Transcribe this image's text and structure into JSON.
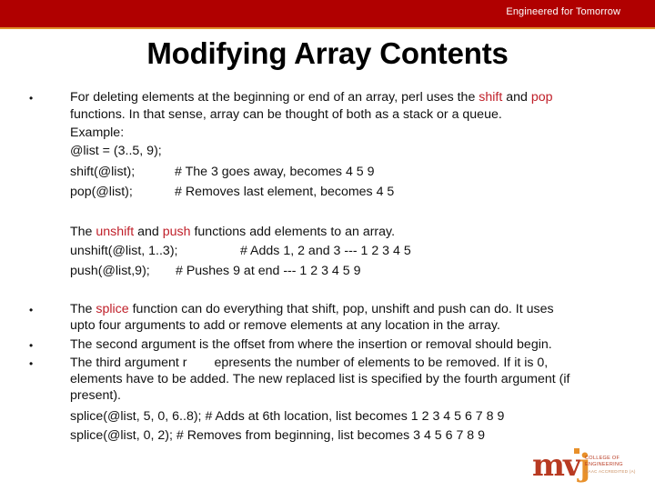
{
  "header": {
    "tagline": "Engineered for Tomorrow",
    "bar_color": "#b00000",
    "accent_color": "#e0902a"
  },
  "slide": {
    "title": "Modifying Array Contents",
    "highlight_color": "#c0202a",
    "section1": {
      "line1_pre": "For deleting elements at the beginning or end of an array, perl uses the ",
      "line1_kw1": "shift",
      "line1_mid": " and ",
      "line1_kw2": "pop",
      "line2": "functions. In that sense, array can be thought of both as a stack or a queue.",
      "example_label": "Example:",
      "code1": "@list = (3..5, 9);",
      "code2_stmt": "shift(@list);",
      "code2_comment": "# The 3 goes away, becomes 4 5 9",
      "code3_stmt": "pop(@list);",
      "code3_comment": "# Removes last element, becomes 4  5"
    },
    "section2": {
      "line1_pre": "The ",
      "line1_kw1": "unshift",
      "line1_mid": " and ",
      "line1_kw2": "push",
      "line1_post": " functions add elements to an array.",
      "code1_stmt": "unshift(@list, 1..3);",
      "code1_comment": "# Adds 1, 2 and 3 --- 1 2 3 4 5",
      "code2_stmt": "push(@list,9);",
      "code2_comment": "# Pushes 9 at end --- 1 2 3 4 5 9"
    },
    "section3": {
      "bullet1_pre": "The ",
      "bullet1_kw": "splice",
      "bullet1_post": " function can do everything that shift, pop, unshift and push can do. It uses",
      "bullet1_line2": "upto four arguments to add or remove elements at any location in the array.",
      "bullet2": "The second argument is the offset from where the insertion or removal should begin.",
      "bullet3_part1": "The third argument r",
      "bullet3_part2": "epresents the number of elements to be removed. If it is 0,",
      "bullet3_line2": "elements have to be added. The new replaced list is specified by the fourth argument (if",
      "bullet3_line3": "present).",
      "code1": "splice(@list, 5, 0, 6..8);   # Adds at 6th location, list becomes 1 2 3 4 5 6 7 8 9",
      "code2": "splice(@list, 0, 2);  # Removes from beginning, list becomes 3 4 5 6 7 8 9"
    },
    "bullet_glyph": "•"
  },
  "logo": {
    "mark_mv": "mv",
    "mark_j": "j",
    "line1": "COLLEGE OF",
    "line2": "ENGINEERING",
    "line3": "NAAC ACCREDITED (A)"
  }
}
